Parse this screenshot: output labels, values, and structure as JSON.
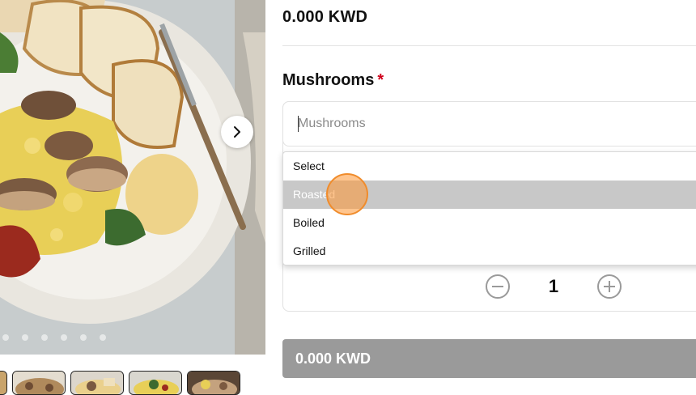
{
  "gallery": {
    "image_alt": "Scrambled eggs with mushrooms, toast and sun-dried tomatoes",
    "next_icon": "chevron-right-icon",
    "dot_count": 6,
    "thumbnail_count": 5
  },
  "product": {
    "price": "0.000 KWD"
  },
  "option_group": {
    "label": "Mushrooms",
    "required_mark": "*",
    "input_placeholder": "Mushrooms",
    "options": [
      "Select",
      "Roasted",
      "Boiled",
      "Grilled"
    ],
    "highlighted_option": "Roasted"
  },
  "quantity": {
    "value": "1",
    "decrement_icon": "minus-circle-icon",
    "increment_icon": "plus-circle-icon"
  },
  "add_to_cart": {
    "label": "0.000 KWD"
  },
  "colors": {
    "accent_click": "#f08c2c",
    "total_bar": "#9a9a9a",
    "required": "#d0021b"
  }
}
